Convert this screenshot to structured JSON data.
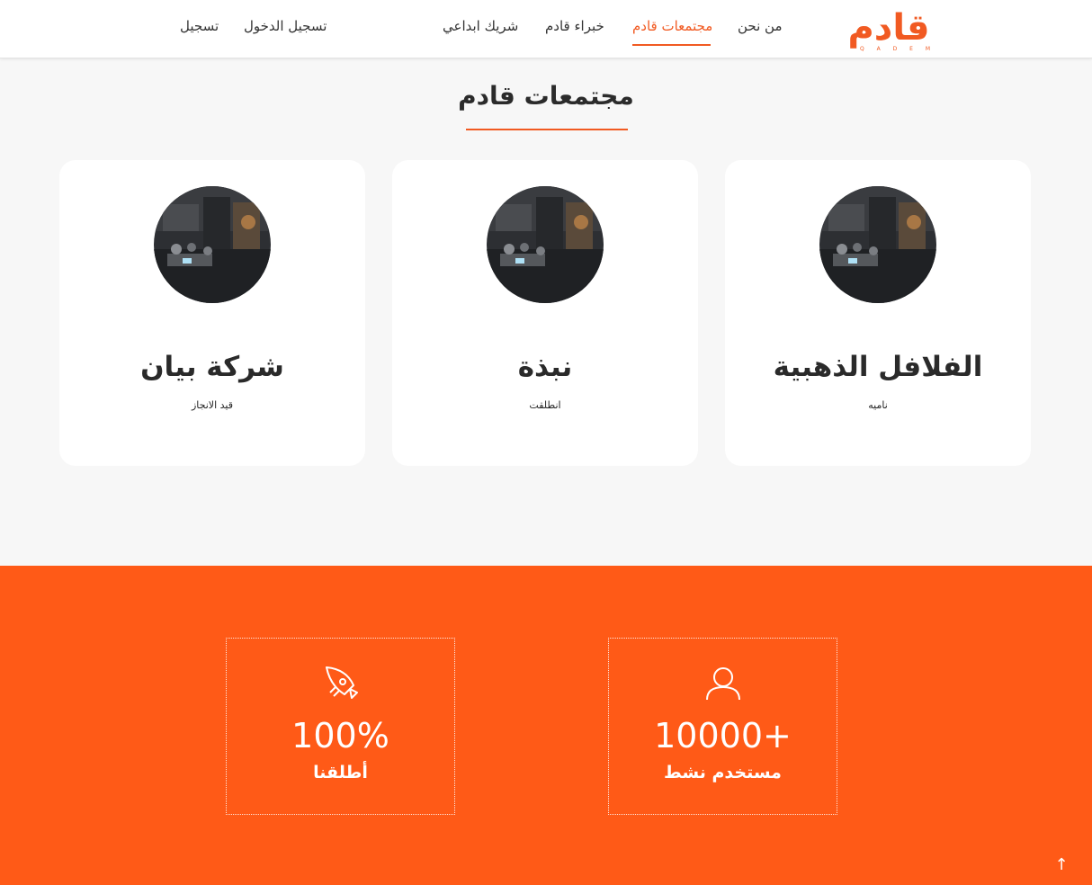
{
  "brand": {
    "logo_text": "قادم",
    "logo_subtext": "Q A D E M",
    "accent_color": "#f15a22"
  },
  "nav": {
    "items": [
      {
        "label": "من نحن",
        "active": false
      },
      {
        "label": "مجتمعات قادم",
        "active": true
      },
      {
        "label": "خبراء قادم",
        "active": false
      },
      {
        "label": "شريك ابداعي",
        "active": false
      }
    ],
    "login_label": "تسجيل الدخول",
    "register_label": "تسجيل"
  },
  "section": {
    "title": "مجتمعات قادم"
  },
  "communities": [
    {
      "name": "الفلافل الذهبية",
      "status": "ناميه",
      "image": "meeting-room-photo"
    },
    {
      "name": "نبذة",
      "status": "انطلقت",
      "image": "meeting-room-photo"
    },
    {
      "name": "شركة بيان",
      "status": "قيد الانجاز",
      "image": "meeting-room-photo"
    }
  ],
  "stats": [
    {
      "icon": "user-icon",
      "value": "10000+",
      "label": "مستخدم نشط"
    },
    {
      "icon": "rocket-icon",
      "value": "100%",
      "label": "أطلقنا"
    }
  ],
  "stats_background_color": "#ff5a17",
  "scroll_top_icon": "arrow-up-icon",
  "scroll_top_glyph": "↑"
}
